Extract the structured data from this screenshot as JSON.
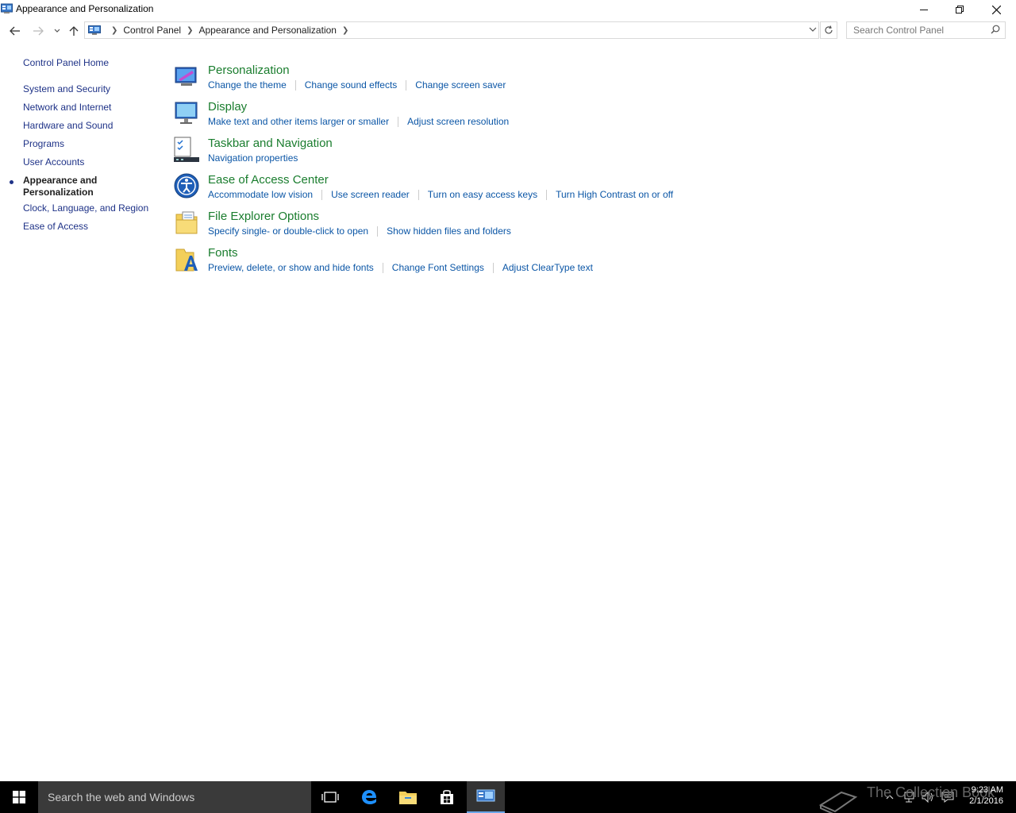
{
  "window": {
    "title": "Appearance and Personalization",
    "minimize_icon": "minimize-icon",
    "maximize_icon": "restore-icon",
    "close_icon": "close-icon"
  },
  "address": {
    "crumbs": [
      "Control Panel",
      "Appearance and Personalization"
    ],
    "search_placeholder": "Search Control Panel"
  },
  "sidebar": {
    "home": "Control Panel Home",
    "items": [
      "System and Security",
      "Network and Internet",
      "Hardware and Sound",
      "Programs",
      "User Accounts",
      "Appearance and Personalization",
      "Clock, Language, and Region",
      "Ease of Access"
    ],
    "active_index": 5
  },
  "categories": [
    {
      "title": "Personalization",
      "icon": "personalization-icon",
      "links": [
        "Change the theme",
        "Change sound effects",
        "Change screen saver"
      ]
    },
    {
      "title": "Display",
      "icon": "display-icon",
      "links": [
        "Make text and other items larger or smaller",
        "Adjust screen resolution"
      ]
    },
    {
      "title": "Taskbar and Navigation",
      "icon": "taskbar-icon",
      "links": [
        "Navigation properties"
      ]
    },
    {
      "title": "Ease of Access Center",
      "icon": "ease-of-access-icon",
      "links": [
        "Accommodate low vision",
        "Use screen reader",
        "Turn on easy access keys",
        "Turn High Contrast on or off"
      ]
    },
    {
      "title": "File Explorer Options",
      "icon": "folder-options-icon",
      "links": [
        "Specify single- or double-click to open",
        "Show hidden files and folders"
      ]
    },
    {
      "title": "Fonts",
      "icon": "fonts-icon",
      "links": [
        "Preview, delete, or show and hide fonts",
        "Change Font Settings",
        "Adjust ClearType text"
      ]
    }
  ],
  "taskbar": {
    "search_text": "Search the web and Windows",
    "time": "9:23 AM",
    "date": "2/1/2016",
    "watermark": "The Collection Book"
  },
  "colors": {
    "link": "#0b56a6",
    "category_title": "#1a7d2e",
    "sidebar_link": "#1e3287",
    "taskbar": "#000000"
  }
}
